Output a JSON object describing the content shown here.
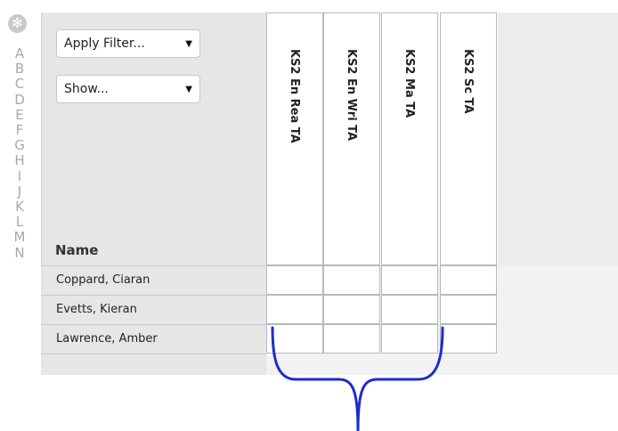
{
  "rail": {
    "letters": [
      "A",
      "B",
      "C",
      "D",
      "E",
      "F",
      "G",
      "H",
      "I",
      "J",
      "K",
      "L",
      "M",
      "N"
    ]
  },
  "filters": {
    "apply_label": "Apply Filter...",
    "show_label": "Show..."
  },
  "table": {
    "name_header": "Name",
    "columns": [
      "KS2 En Rea TA",
      "KS2 En Wri TA",
      "KS2 Ma TA",
      "KS2 Sc TA"
    ],
    "rows": [
      "Coppard, Ciaran",
      "Evetts, Kieran",
      "Lawrence, Amber"
    ]
  },
  "annotation": {
    "color": "#1a2ecf"
  }
}
